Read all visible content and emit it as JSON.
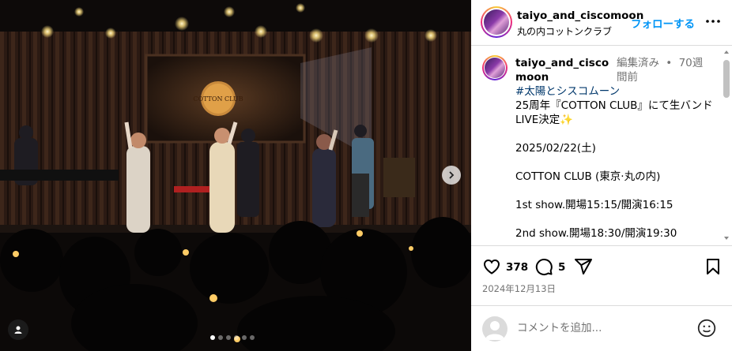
{
  "post": {
    "username": "taiyo_and_ciscomoon",
    "location": "丸の内コットンクラブ",
    "follow_label": "フォローする",
    "caption_username": "taiyo_and_ciscomoon",
    "edited_label": "編集済み",
    "separator": "•",
    "age": "70週間前",
    "hashtag": "#太陽とシスコムーン",
    "caption_lines": [
      "25周年『COTTON CLUB』にて生バンドLIVE決定",
      "",
      "2025/02/22(土)",
      "",
      "COTTON CLUB (東京·丸の内)",
      "",
      "1st show.開場15:15/開演16:15",
      "",
      "2nd show.開場18:30/開演19:30"
    ],
    "sparkle_icon": "sparkles-emoji",
    "likes": "378",
    "comments": "5",
    "date": "2024年12月13日",
    "comment_placeholder": "コメントを追加...",
    "carousel_dots": 6,
    "carousel_active": 0
  },
  "media": {
    "venue_sign": "COTTON CLUB",
    "icons": [
      "chevron-right-icon",
      "user-tag-icon"
    ]
  },
  "colors": {
    "accent": "#0095f6",
    "hashtag": "#00376b",
    "muted": "#737373",
    "border": "#dbdbdb"
  }
}
